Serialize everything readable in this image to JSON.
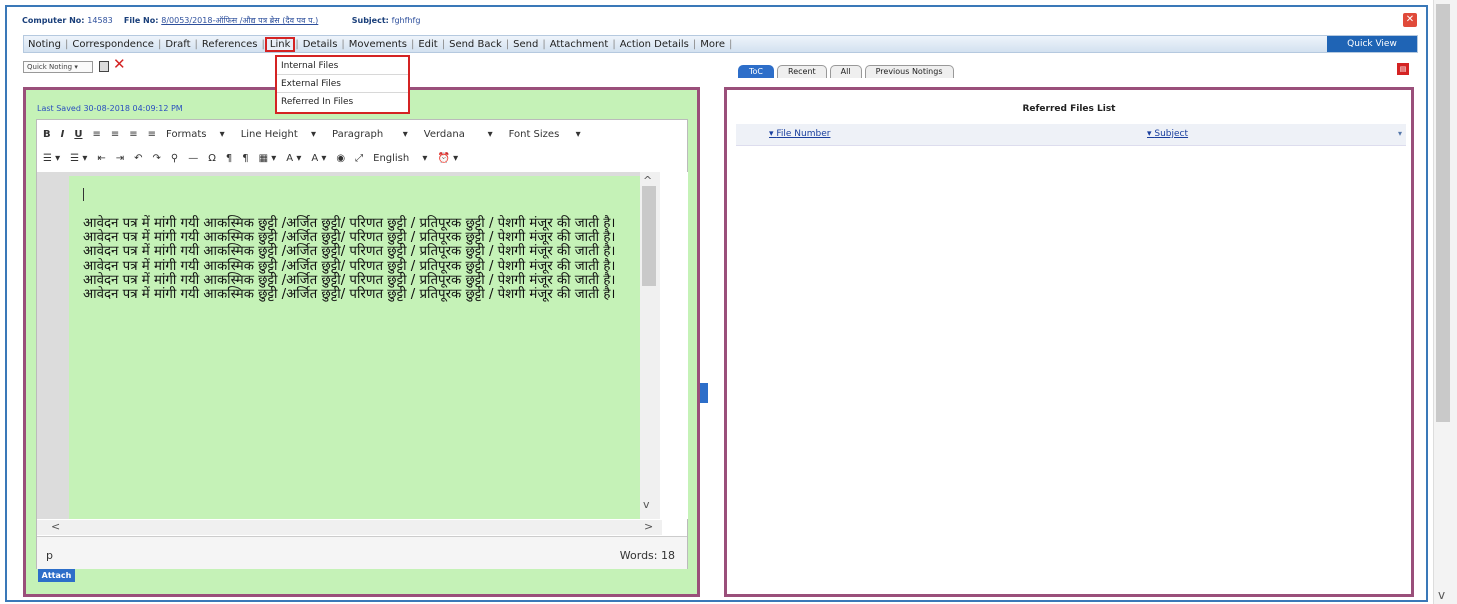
{
  "header": {
    "computer_no_label": "Computer No:",
    "computer_no": "14583",
    "file_no_label": "File No:",
    "file_no": "8/0053/2018-ऑफिस /औद्य पत्र ब्रेस (दैव पव प.)",
    "subject_label": "Subject:",
    "subject": "fghfhfg"
  },
  "menu": {
    "items": [
      "Noting",
      "Correspondence",
      "Draft",
      "References",
      "Link",
      "Details",
      "Movements",
      "Edit",
      "Send Back",
      "Send",
      "Attachment",
      "Action Details",
      "More"
    ],
    "active": "Link",
    "quick_view": "Quick View"
  },
  "link_dropdown": [
    "Internal Files",
    "External Files",
    "Referred In Files"
  ],
  "noting": {
    "quick_noting": "Quick Noting",
    "last_saved": "Last Saved 30-08-2018 04:09:12 PM",
    "toolbar_row1": [
      "B",
      "I",
      "U",
      "Formats",
      "Line Height",
      "Paragraph",
      "Verdana",
      "Font Sizes"
    ],
    "toolbar_row2_language": "English",
    "body": "आवेदन पत्र में मांगी गयी आकस्मिक छुट्टी /अर्जित छुट्टी/ परिणत छुट्टी / प्रतिपूरक छुट्टी / पेशगी मंजूर की जाती है। आवेदन पत्र में मांगी गयी आकस्मिक छुट्टी /अर्जित छुट्टी/ परिणत छुट्टी / प्रतिपूरक छुट्टी / पेशगी मंजूर की जाती है। आवेदन पत्र में मांगी गयी आकस्मिक छुट्टी /अर्जित छुट्टी/ परिणत छुट्टी / प्रतिपूरक छुट्टी / पेशगी मंजूर की जाती है। आवेदन पत्र में मांगी गयी आकस्मिक छुट्टी /अर्जित छुट्टी/ परिणत छुट्टी / प्रतिपूरक छुट्टी / पेशगी मंजूर की जाती है। आवेदन पत्र में मांगी गयी आकस्मिक छुट्टी /अर्जित छुट्टी/ परिणत छुट्टी / प्रतिपूरक छुट्टी / पेशगी मंजूर की जाती है। आवेदन पत्र में मांगी गयी आकस्मिक छुट्टी /अर्जित छुट्टी/ परिणत छुट्टी / प्रतिपूरक छुट्टी / पेशगी मंजूर की जाती है।",
    "status_element": "p",
    "word_count": "Words: 18",
    "attach": "Attach"
  },
  "right_tabs": [
    "ToC",
    "Recent",
    "All",
    "Previous Notings"
  ],
  "referred_files": {
    "title": "Referred Files List",
    "columns": [
      "File Number",
      "Subject"
    ]
  }
}
